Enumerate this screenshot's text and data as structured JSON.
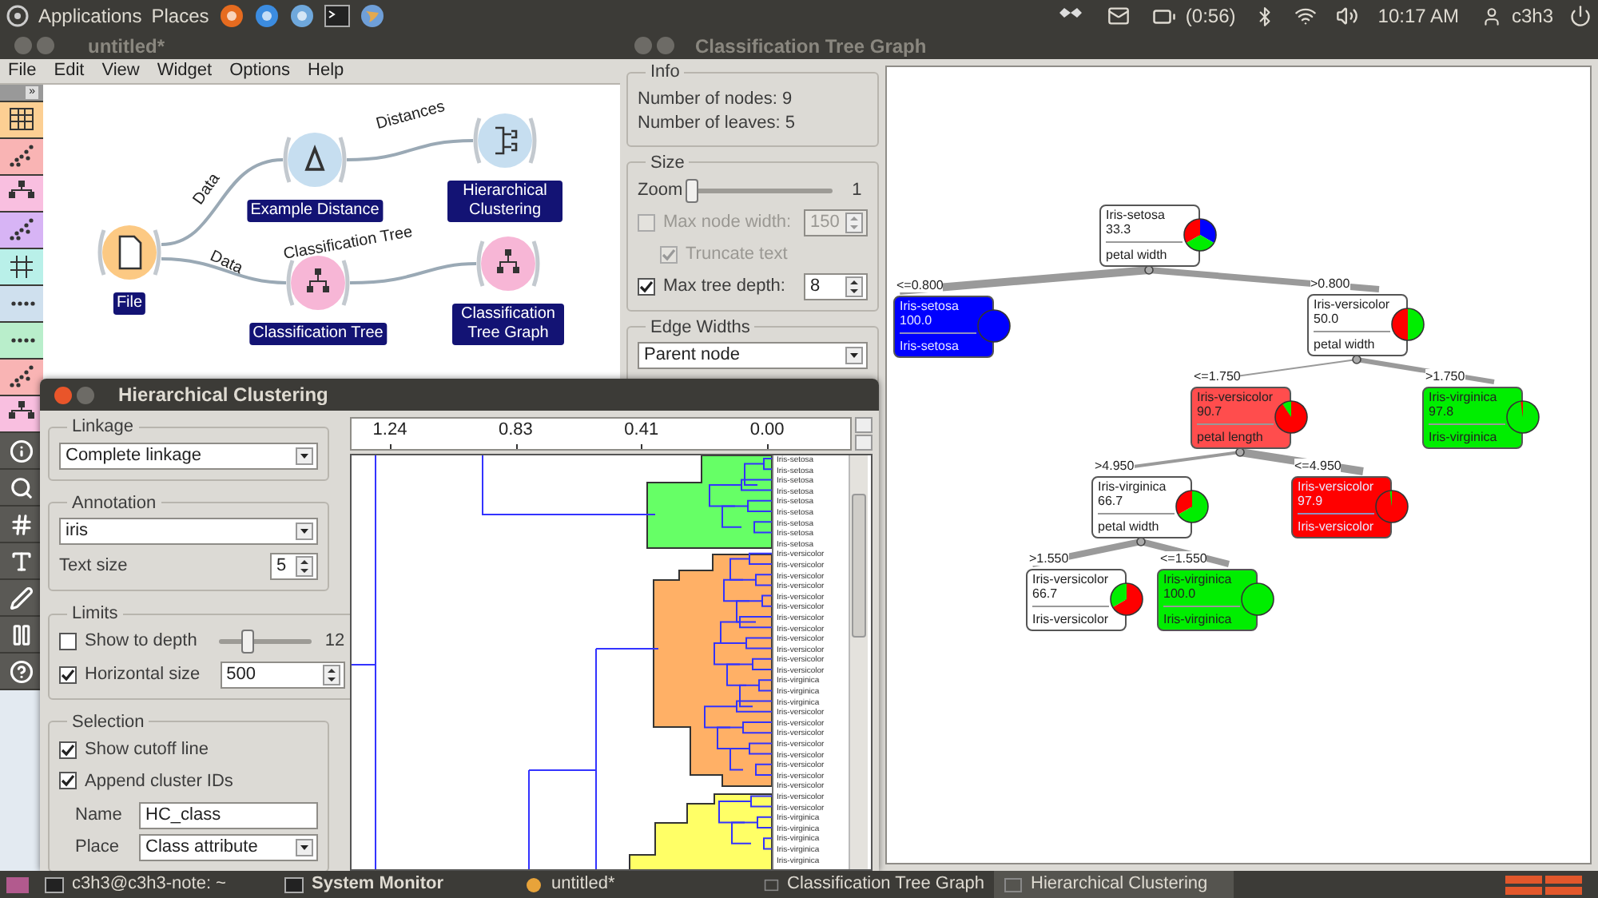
{
  "top_panel": {
    "menus": [
      "Applications",
      "Places"
    ],
    "battery": "(0:56)",
    "clock": "10:17 AM",
    "user": "c3h3"
  },
  "canvas_window": {
    "title": "untitled*",
    "menu": [
      "File",
      "Edit",
      "View",
      "Widget",
      "Options",
      "Help"
    ],
    "toolbox_toggle": "»",
    "widgets": [
      {
        "kind": "file",
        "label": "File"
      },
      {
        "kind": "distance",
        "label": "Example Distance"
      },
      {
        "kind": "clustering",
        "label": "Hierarchical Clustering"
      },
      {
        "kind": "tree",
        "label": "Classification Tree"
      },
      {
        "kind": "tree_graph",
        "label": "Classification Tree Graph"
      }
    ],
    "links": [
      {
        "label": "Data"
      },
      {
        "label": "Data"
      },
      {
        "label": "Distances"
      },
      {
        "label": "Classification Tree"
      }
    ]
  },
  "tree_window": {
    "title": "Classification Tree Graph",
    "info": {
      "title": "Info",
      "lines": [
        "Number of nodes: 9",
        "Number of leaves: 5"
      ]
    },
    "size": {
      "title": "Size",
      "zoom_label": "Zoom",
      "zoom": {
        "level": 0
      },
      "zoom_value": "1",
      "max_node_width": {
        "label": "Max node width:",
        "checked": false,
        "value": "150",
        "disabled": true
      },
      "truncate": {
        "label": "Truncate text",
        "checked": true,
        "disabled": true
      },
      "max_depth": {
        "label": "Max tree depth:",
        "checked": true,
        "value": "8",
        "disabled": false
      }
    },
    "edge_widths": {
      "title": "Edge Widths",
      "value": "Parent node"
    },
    "tree": {
      "class": "Iris-setosa",
      "percent": "33.3",
      "split": "petal width",
      "color": "#ffffff",
      "children": [
        {
          "condition": "<=0.800",
          "class": "Iris-setosa",
          "percent": "100.0",
          "split": "Iris-setosa",
          "color": "#0000ff"
        },
        {
          "condition": ">0.800",
          "class": "Iris-versicolor",
          "percent": "50.0",
          "split": "petal width",
          "color": "#ffffff",
          "children": [
            {
              "condition": "<=1.750",
              "class": "Iris-versicolor",
              "percent": "90.7",
              "split": "petal length",
              "color": "#ff4d4d",
              "children": [
                {
                  "condition": ">4.950",
                  "class": "Iris-virginica",
                  "percent": "66.7",
                  "split": "petal width",
                  "color": "#ffffff",
                  "children": [
                    {
                      "condition": ">1.550",
                      "class": "Iris-versicolor",
                      "percent": "66.7",
                      "split": "Iris-versicolor",
                      "color": "#ffffff"
                    },
                    {
                      "condition": "<=1.550",
                      "class": "Iris-virginica",
                      "percent": "100.0",
                      "split": "Iris-virginica",
                      "color": "#00ee00"
                    }
                  ]
                },
                {
                  "condition": "<=4.950",
                  "class": "Iris-versicolor",
                  "percent": "97.9",
                  "split": "Iris-versicolor",
                  "color": "#ff0000"
                }
              ]
            },
            {
              "condition": ">1.750",
              "class": "Iris-virginica",
              "percent": "97.8",
              "split": "Iris-virginica",
              "color": "#00ee00"
            }
          ]
        }
      ]
    }
  },
  "clustering_window": {
    "title": "Hierarchical Clustering",
    "linkage": {
      "title": "Linkage",
      "value": "Complete linkage"
    },
    "annotation": {
      "title": "Annotation",
      "value": "iris",
      "text_size_label": "Text size",
      "text_size": "5"
    },
    "limits": {
      "title": "Limits",
      "depth": {
        "label": "Show to depth",
        "checked": false,
        "level": 0.3,
        "value": "12"
      },
      "horizontal": {
        "label": "Horizontal size",
        "checked": true,
        "value": "500"
      }
    },
    "selection": {
      "title": "Selection",
      "cutoff": {
        "label": "Show cutoff line",
        "checked": true
      },
      "append": {
        "label": "Append cluster IDs",
        "checked": true
      },
      "name_label": "Name",
      "name": "HC_class",
      "place_label": "Place",
      "place": "Class attribute"
    },
    "axis_ticks": [
      "1.24",
      "0.83",
      "0.41",
      "0.00"
    ],
    "leaves": [
      "Iris-setosa",
      "Iris-setosa",
      "Iris-setosa",
      "Iris-setosa",
      "Iris-setosa",
      "Iris-setosa",
      "Iris-setosa",
      "Iris-setosa",
      "Iris-setosa",
      "Iris-versicolor",
      "Iris-versicolor",
      "Iris-versicolor",
      "Iris-versicolor",
      "Iris-versicolor",
      "Iris-versicolor",
      "Iris-versicolor",
      "Iris-versicolor",
      "Iris-versicolor",
      "Iris-versicolor",
      "Iris-versicolor",
      "Iris-versicolor",
      "Iris-virginica",
      "Iris-virginica",
      "Iris-virginica",
      "Iris-versicolor",
      "Iris-versicolor",
      "Iris-versicolor",
      "Iris-versicolor",
      "Iris-versicolor",
      "Iris-versicolor",
      "Iris-versicolor",
      "Iris-versicolor",
      "Iris-versicolor",
      "Iris-versicolor",
      "Iris-virginica",
      "Iris-virginica",
      "Iris-virginica",
      "Iris-virginica",
      "Iris-virginica"
    ]
  },
  "taskbar": [
    {
      "kind": "terminal",
      "label": "c3h3@c3h3-note: ~",
      "selected": false
    },
    {
      "kind": "monitor",
      "label": "System Monitor",
      "selected": false
    },
    {
      "kind": "orange",
      "label": "untitled*",
      "selected": false
    },
    {
      "kind": "window",
      "label": "Classification Tree Graph",
      "selected": false
    },
    {
      "kind": "window",
      "label": "Hierarchical Clustering",
      "selected": true
    }
  ]
}
